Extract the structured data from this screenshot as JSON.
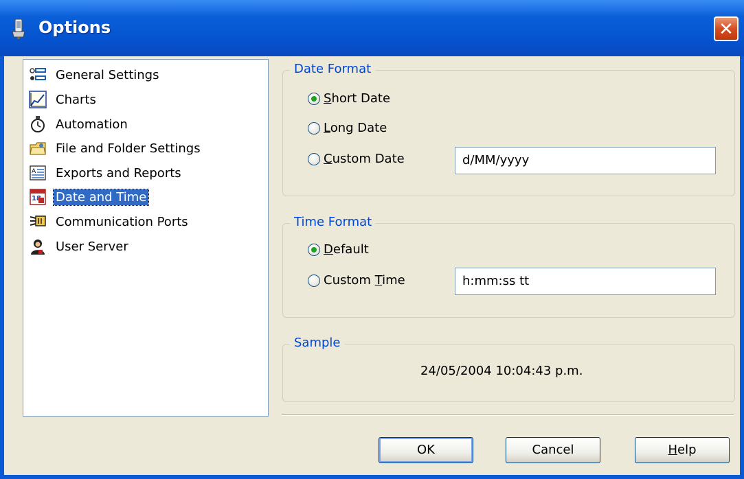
{
  "window": {
    "title": "Options",
    "close_symbol": "✕"
  },
  "tree": {
    "items": [
      {
        "label": "General Settings",
        "icon": "general-settings-icon"
      },
      {
        "label": "Charts",
        "icon": "chart-icon"
      },
      {
        "label": "Automation",
        "icon": "stopwatch-icon"
      },
      {
        "label": "File and Folder Settings",
        "icon": "folder-icon"
      },
      {
        "label": "Exports and Reports",
        "icon": "report-icon"
      },
      {
        "label": "Date and Time",
        "icon": "calendar-icon",
        "selected": true
      },
      {
        "label": "Communication Ports",
        "icon": "port-icon"
      },
      {
        "label": "User Server",
        "icon": "user-icon"
      }
    ]
  },
  "date_format": {
    "title": "Date Format",
    "short_date": {
      "mnemonic": "S",
      "rest": "hort Date",
      "checked": true
    },
    "long_date": {
      "mnemonic": "L",
      "rest": "ong Date",
      "checked": false
    },
    "custom_date": {
      "mnemonic": "C",
      "rest": "ustom Date",
      "checked": false,
      "value": "d/MM/yyyy"
    }
  },
  "time_format": {
    "title": "Time Format",
    "default": {
      "mnemonic": "D",
      "rest": "efault",
      "checked": true
    },
    "custom_time": {
      "prefix": "Custom ",
      "mnemonic": "T",
      "rest": "ime",
      "checked": false,
      "value": "h:mm:ss tt"
    }
  },
  "sample": {
    "title": "Sample",
    "value": "24/05/2004 10:04:43 p.m."
  },
  "buttons": {
    "ok": "OK",
    "cancel": "Cancel",
    "help_mnemonic": "H",
    "help_rest": "elp"
  },
  "colors": {
    "accent": "#0046d5",
    "selection": "#316ac5",
    "title_bar": "#0553d0",
    "check_dot": "#21a121"
  }
}
